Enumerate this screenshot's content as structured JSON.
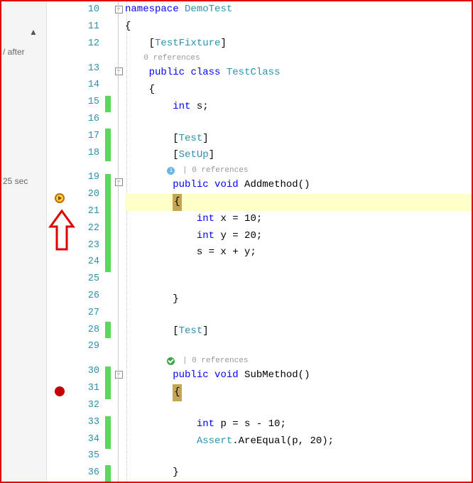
{
  "sidebar": {
    "text1": "/ after",
    "text2": "25 sec"
  },
  "refs": {
    "plain": "0 references",
    "withSep": " | 0 references"
  },
  "lines": [
    {
      "num": "10",
      "chg": false,
      "outline": "minus",
      "tokens": [
        [
          "kw",
          "namespace"
        ],
        [
          "txt",
          " "
        ],
        [
          "type",
          "DemoTest"
        ]
      ]
    },
    {
      "num": "11",
      "chg": false,
      "outline": "",
      "tokens": [
        [
          "txt",
          "{"
        ]
      ]
    },
    {
      "num": "12",
      "chg": false,
      "outline": "",
      "tokens": [
        [
          "txt",
          "    ["
        ],
        [
          "type",
          "TestFixture"
        ],
        [
          "txt",
          "]"
        ]
      ]
    },
    {
      "ref": "plain",
      "indent": "    "
    },
    {
      "num": "13",
      "chg": false,
      "outline": "minus",
      "tokens": [
        [
          "txt",
          "    "
        ],
        [
          "kw",
          "public"
        ],
        [
          "txt",
          " "
        ],
        [
          "kw",
          "class"
        ],
        [
          "txt",
          " "
        ],
        [
          "type",
          "TestClass"
        ]
      ]
    },
    {
      "num": "14",
      "chg": false,
      "outline": "",
      "tokens": [
        [
          "txt",
          "    {"
        ]
      ]
    },
    {
      "num": "15",
      "chg": true,
      "outline": "",
      "tokens": [
        [
          "txt",
          "        "
        ],
        [
          "kw",
          "int"
        ],
        [
          "txt",
          " s;"
        ]
      ]
    },
    {
      "num": "16",
      "chg": false,
      "outline": "",
      "tokens": []
    },
    {
      "num": "17",
      "chg": true,
      "outline": "",
      "tokens": [
        [
          "txt",
          "        ["
        ],
        [
          "type",
          "Test"
        ],
        [
          "txt",
          "]"
        ]
      ]
    },
    {
      "num": "18",
      "chg": true,
      "outline": "",
      "tokens": [
        [
          "txt",
          "        ["
        ],
        [
          "type",
          "SetUp"
        ],
        [
          "txt",
          "]"
        ]
      ]
    },
    {
      "ref": "info",
      "indent": "         "
    },
    {
      "num": "19",
      "chg": true,
      "outline": "minus",
      "tokens": [
        [
          "txt",
          "        "
        ],
        [
          "kw",
          "public"
        ],
        [
          "txt",
          " "
        ],
        [
          "kw",
          "void"
        ],
        [
          "txt",
          " Addmethod()"
        ]
      ]
    },
    {
      "num": "20",
      "chg": true,
      "outline": "",
      "bp": "current",
      "highlight": true,
      "tokens": [
        [
          "txt",
          "        "
        ],
        [
          "curstmt",
          "{"
        ]
      ]
    },
    {
      "num": "21",
      "chg": true,
      "outline": "",
      "tokens": [
        [
          "txt",
          "            "
        ],
        [
          "kw",
          "int"
        ],
        [
          "txt",
          " x = 10;"
        ]
      ]
    },
    {
      "num": "22",
      "chg": true,
      "outline": "",
      "tokens": [
        [
          "txt",
          "            "
        ],
        [
          "kw",
          "int"
        ],
        [
          "txt",
          " y = 20;"
        ]
      ]
    },
    {
      "num": "23",
      "chg": true,
      "outline": "",
      "tokens": [
        [
          "txt",
          "            s = x + y;"
        ]
      ]
    },
    {
      "num": "24",
      "chg": true,
      "outline": "",
      "tokens": []
    },
    {
      "num": "25",
      "chg": false,
      "outline": "",
      "tokens": []
    },
    {
      "num": "26",
      "chg": false,
      "outline": "",
      "tokens": [
        [
          "txt",
          "        }"
        ]
      ]
    },
    {
      "num": "27",
      "chg": false,
      "outline": "",
      "tokens": []
    },
    {
      "num": "28",
      "chg": true,
      "outline": "",
      "tokens": [
        [
          "txt",
          "        ["
        ],
        [
          "type",
          "Test"
        ],
        [
          "txt",
          "]"
        ]
      ]
    },
    {
      "num": "29",
      "chg": false,
      "outline": "",
      "tokens": []
    },
    {
      "ref": "pass",
      "indent": "         "
    },
    {
      "num": "30",
      "chg": true,
      "outline": "minus",
      "tokens": [
        [
          "txt",
          "        "
        ],
        [
          "kw",
          "public"
        ],
        [
          "txt",
          " "
        ],
        [
          "kw",
          "void"
        ],
        [
          "txt",
          " SubMethod()"
        ]
      ]
    },
    {
      "num": "31",
      "chg": true,
      "outline": "",
      "bp": "normal",
      "tokens": [
        [
          "txt",
          "        "
        ],
        [
          "brace",
          "{"
        ]
      ]
    },
    {
      "num": "32",
      "chg": false,
      "outline": "",
      "tokens": []
    },
    {
      "num": "33",
      "chg": true,
      "outline": "",
      "tokens": [
        [
          "txt",
          "            "
        ],
        [
          "kw",
          "int"
        ],
        [
          "txt",
          " p = s - 10;"
        ]
      ]
    },
    {
      "num": "34",
      "chg": true,
      "outline": "",
      "tokens": [
        [
          "txt",
          "            "
        ],
        [
          "type",
          "Assert"
        ],
        [
          "txt",
          ".AreEqual(p, 20);"
        ]
      ]
    },
    {
      "num": "35",
      "chg": false,
      "outline": "",
      "tokens": []
    },
    {
      "num": "36",
      "chg": true,
      "outline": "",
      "tokens": [
        [
          "txt",
          "        }"
        ]
      ]
    }
  ]
}
